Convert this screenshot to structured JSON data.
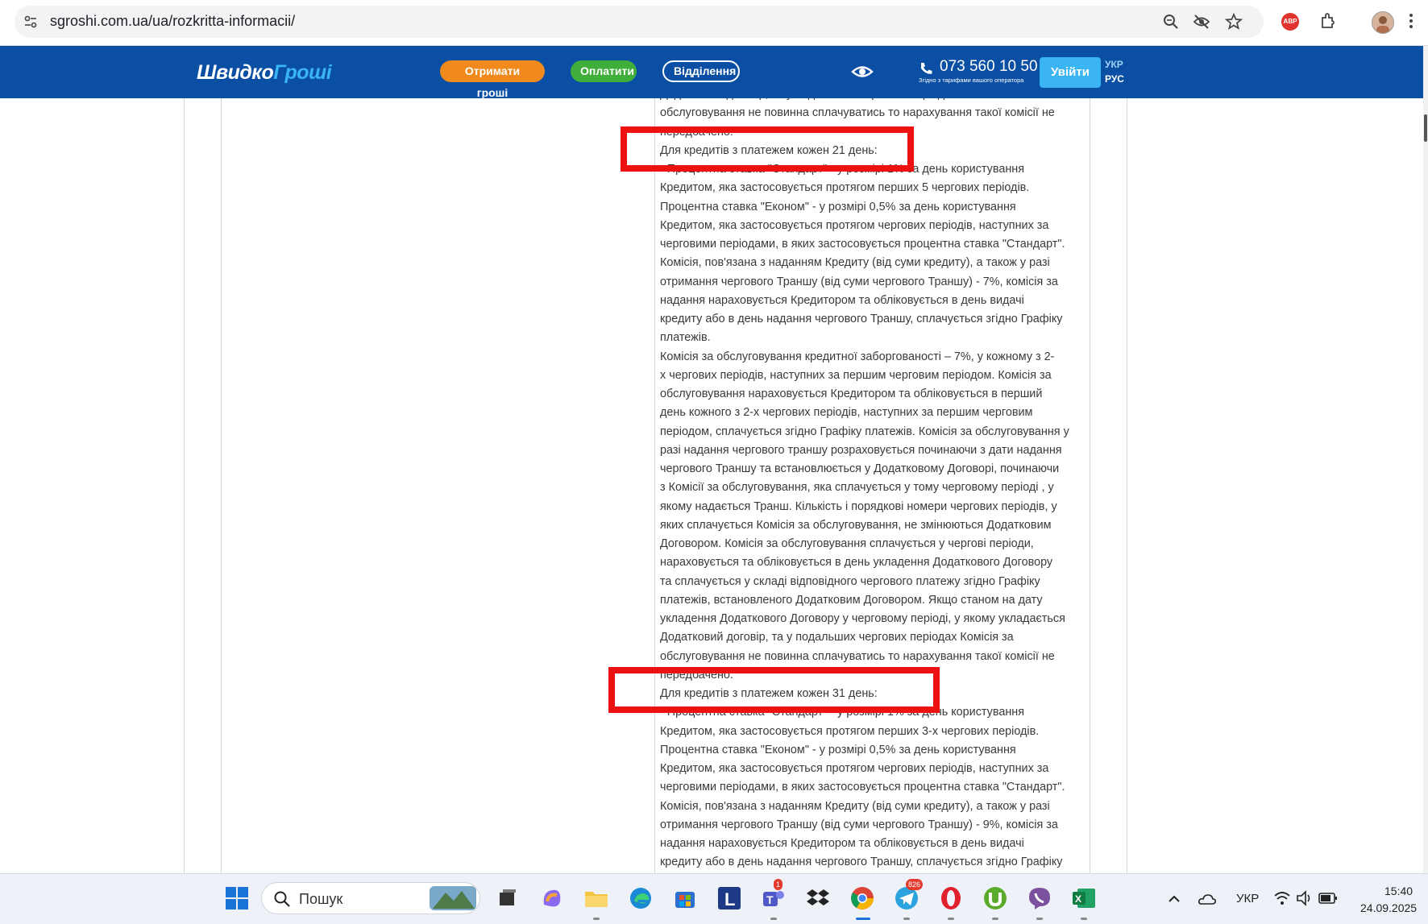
{
  "browser": {
    "url": "sgroshi.com.ua/ua/rozkritta-informacii/",
    "icons": [
      "site-settings-icon",
      "zoom-icon",
      "eye-off-icon",
      "star-icon",
      "adblock-icon",
      "extensions-icon",
      "profile-avatar",
      "more-icon"
    ],
    "abp_label": "ABP"
  },
  "header": {
    "logo_part1": "Швидко",
    "logo_part2": "Гроші",
    "btn_get_money": "Отримати гроші",
    "btn_pay": "Оплатити",
    "btn_branches": "Відділення",
    "phone": "073 560 10 50",
    "phone_note": "Згідно з тарифами вашого оператора",
    "login": "Увійти",
    "lang_ukr": "УКР",
    "lang_rus": "РУС",
    "colors": {
      "bar": "#0a4fa3",
      "orange": "#f08a1c",
      "green": "#3fae3a",
      "accent": "#3ab4f2"
    }
  },
  "content": {
    "lines": [
      "Додатковий договір, та у подальших чергових періодах Комісія за",
      "обслуговування не повинна сплачуватись то нарахування такої комісії не",
      "передбачено.",
      "Для кредитів з платежем кожен 21 день:",
      "- Процентна ставка \"Стандарт\" - у розмірі 1% за день користування",
      "Кредитом, яка застосовується протягом перших 5 чергових періодів.",
      " Процентна ставка \"Економ\" - у розмірі 0,5% за день користування",
      "Кредитом, яка застосовується протягом чергових періодів, наступних за",
      "черговими періодами, в яких застосовується процентна ставка \"Стандарт\".",
      "Комісія, пов'язана з наданням Кредиту (від суми кредиту), а також у разі",
      "отримання чергового Траншу (від суми чергового Траншу) - 7%, комісія за",
      "надання нараховується Кредитором та обліковується в день видачі",
      "кредиту або в день надання чергового Траншу, сплачується згідно Графіку",
      "платежів.",
      " Комісія за обслуговування кредитної заборгованості   – 7%, у кожному   з 2-",
      "х чергових періодів, наступних за першим черговим періодом. Комісія за",
      "обслуговування нараховується Кредитором та обліковується в перший",
      "день кожного з 2-х чергових періодів, наступних за першим черговим",
      "періодом, сплачується згідно Графіку платежів. Комісія за обслуговування у",
      "разі надання чергового траншу розраховується починаючи з дати надання",
      "чергового Траншу та встановлюється у Додатковому Договорі, починаючи",
      "з Комісії за обслуговування, яка сплачується у тому черговому періоді , у",
      "якому надається Транш. Кількість і порядкові номери чергових періодів, у",
      "яких сплачується Комісія за обслуговування, не змінюються Додатковим",
      "Договором. Комісія за обслуговування сплачується у чергові періоди,",
      "нараховується та обліковується в день укладення Додаткового Договору",
      "та сплачується у складі відповідного чергового платежу згідно Графіку",
      "платежів, встановленого Додатковим Договором. Якщо станом на дату",
      "укладення Додаткового Договору у черговому періоді, у якому укладається",
      "Додатковий договір, та у подальших чергових періодах Комісія за",
      "обслуговування не повинна сплачуватись то нарахування такої комісії не",
      "передбачено.",
      "Для кредитів з платежем кожен 31 день:",
      "- Процентна ставка \"Стандарт\" - у розмірі 1% за день користування",
      "Кредитом, яка застосовується протягом перших 3-х чергових періодів.",
      " Процентна ставка \"Економ\" - у розмірі 0,5% за день користування",
      "Кредитом, яка застосовується протягом чергових періодів, наступних за",
      "черговими періодами, в яких застосовується процентна ставка \"Стандарт\".",
      "Комісія, пов'язана з наданням Кредиту (від суми кредиту), а також у разі",
      "отримання чергового Траншу (від суми чергового Траншу) - 9%, комісія за",
      "надання нараховується Кредитором та обліковується в день видачі",
      "кредиту або в день надання чергового Траншу, сплачується згідно Графіку"
    ],
    "highlight_color": "#ee1111"
  },
  "taskbar": {
    "search_placeholder": "Пошук",
    "teams_badge": "1",
    "telegram_badge": "826",
    "lang": "УКР",
    "time": "15:40",
    "date": "24.09.2025"
  }
}
